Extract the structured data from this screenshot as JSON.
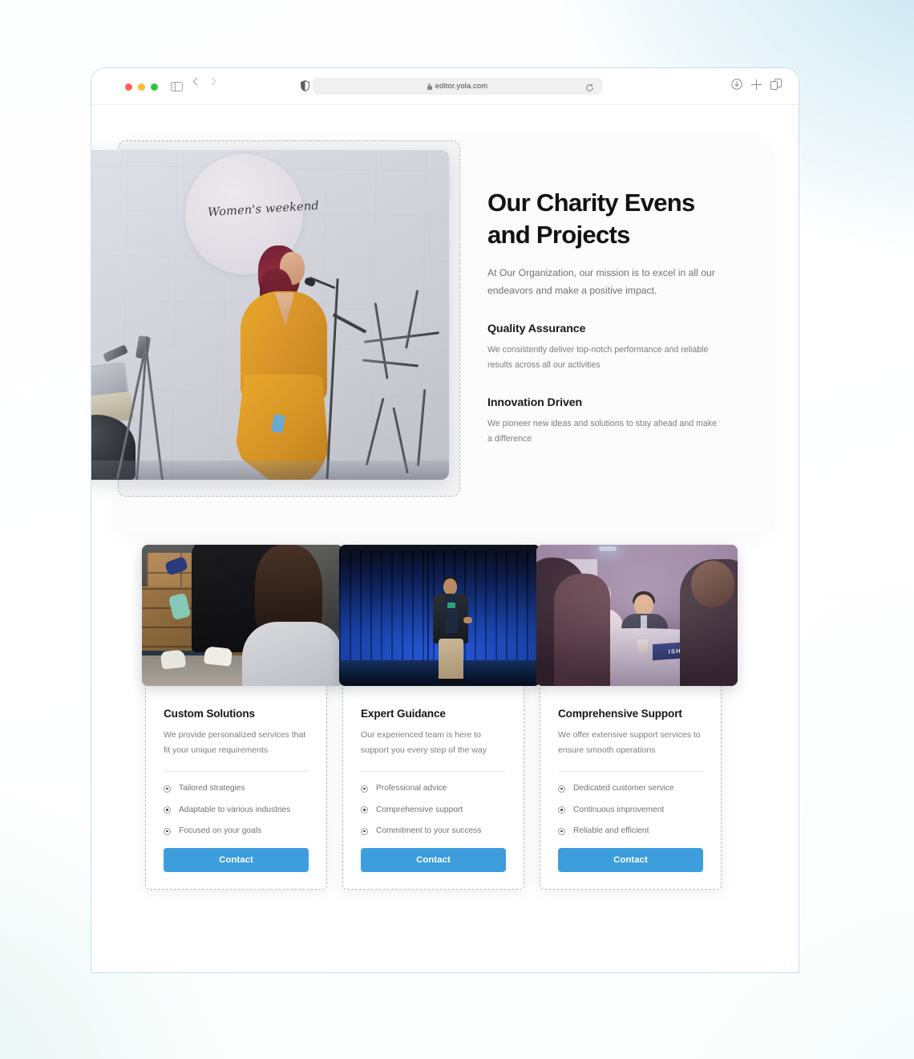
{
  "browser": {
    "url": "editor.yola.com",
    "traffic_lights": [
      "close",
      "minimize",
      "maximize"
    ],
    "icons": {
      "sidebar": "sidebar-toggle-icon",
      "back": "back-chevron-icon",
      "forward": "forward-chevron-icon",
      "shield": "privacy-shield-icon",
      "lock": "lock-icon",
      "reload": "reload-icon",
      "download": "download-icon",
      "new_tab": "plus-icon",
      "tab_overview": "tabs-icon"
    }
  },
  "hero": {
    "image_alt": "Woman in yellow dress speaking at a microphone under a Women's weekend sign",
    "image_caption": "Women's weekend",
    "title": "Our Charity Evens and Projects",
    "subtitle": "At Our Organization, our mission is to excel in all our endeavors and make a positive impact.",
    "features": [
      {
        "title": "Quality Assurance",
        "description": "We consistently deliver top-notch performance and reliable results across all our activities"
      },
      {
        "title": "Innovation Driven",
        "description": "We pioneer new ideas and solutions to stay ahead and make a difference"
      }
    ]
  },
  "cards": [
    {
      "image_alt": "Volunteers carrying cardboard boxes at a food drive",
      "title": "Custom Solutions",
      "description": "We provide personalized services that fit your unique requirements",
      "items": [
        "Tailored strategies",
        "Adaptable to various industries",
        "Focused on your goals"
      ],
      "button": "Contact"
    },
    {
      "image_alt": "Speaker presenting on a stage with a blue curtain backdrop",
      "title": "Expert Guidance",
      "description": "Our experienced team is here to support you every step of the way",
      "items": [
        "Professional advice",
        "Comprehensive support",
        "Commitment to your success"
      ],
      "button": "Contact"
    },
    {
      "image_alt": "People seated around a round table at a conference with an ISHII nameplate",
      "image_nameplate": "ISHII",
      "title": "Comprehensive Support",
      "description": "We offer extensive support services to ensure smooth operations",
      "items": [
        "Dedicated customer service",
        "Continuous improvement",
        "Reliable and efficient"
      ],
      "button": "Contact"
    }
  ],
  "colors": {
    "accent_button": "#3d9ddd",
    "window_border": "#c2e0ef",
    "heading": "#111215",
    "body_text": "#7b7e83",
    "selection_dash": "#bcbcbc"
  }
}
